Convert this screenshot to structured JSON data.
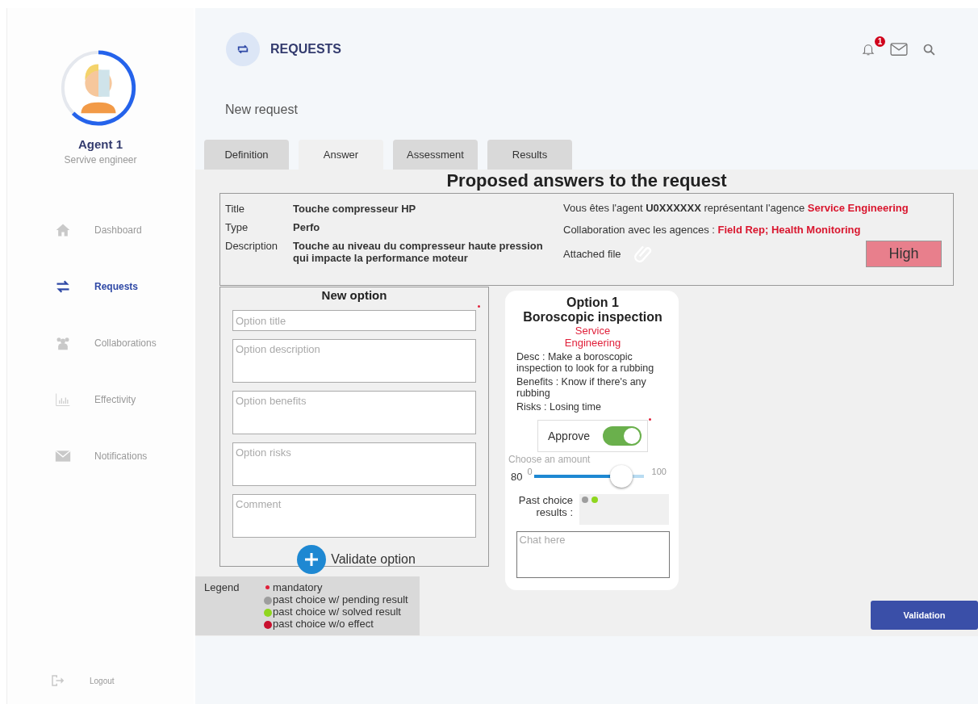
{
  "profile": {
    "name": "Agent 1",
    "role": "Servive engineer"
  },
  "nav": [
    {
      "label": "Dashboard",
      "selected": false
    },
    {
      "label": "Requests",
      "selected": true
    },
    {
      "label": "Collaborations",
      "selected": false
    },
    {
      "label": "Effectivity",
      "selected": false
    },
    {
      "label": "Notifications",
      "selected": false
    }
  ],
  "logout": "Logout",
  "header": {
    "title": "REQUESTS",
    "notification_count": "1",
    "subtitle": "New request"
  },
  "tabs": [
    {
      "label": "Definition",
      "selected": false
    },
    {
      "label": "Answer",
      "selected": true
    },
    {
      "label": "Assessment",
      "selected": false
    },
    {
      "label": "Results",
      "selected": false
    }
  ],
  "heading": "Proposed answers to the request",
  "request": {
    "fields": [
      {
        "label": "Title",
        "value": "Touche compresseur HP"
      },
      {
        "label": "Type",
        "value": "Perfo"
      },
      {
        "label": "Description",
        "value": "Touche au niveau du compresseur haute pression qui impacte la performance moteur"
      }
    ],
    "agent_line": "Vous êtes l'agent **U0XXXXXX** représentant l'agence ",
    "agent_agency": "Service Engineering",
    "collab_line": "Collaboration avec les agences : ",
    "collab_agencies": "Field Rep; Health Monitoring",
    "attached_label": "Attached file",
    "priority": "High"
  },
  "new_option": {
    "title": "New option",
    "fields": [
      {
        "kind": "line",
        "placeholder": "Option title",
        "mandatory": true
      },
      {
        "kind": "area",
        "placeholder": "Option description",
        "mandatory": false
      },
      {
        "kind": "area",
        "placeholder": "Option benefits",
        "mandatory": false
      },
      {
        "kind": "area",
        "placeholder": "Option risks",
        "mandatory": false
      },
      {
        "kind": "area",
        "placeholder": "Comment",
        "mandatory": false
      }
    ],
    "button": "Validate option"
  },
  "option_card": {
    "number": "Option 1",
    "name": "Boroscopic inspection",
    "agency": "Service Engineering",
    "lines": [
      "Desc : Make a boroscopic inspection to look for a rubbing",
      "Benefits : Know if there's any rubbing",
      "Risks : Losing time"
    ],
    "approve": {
      "label": "Approve",
      "on": true,
      "mandatory": true
    },
    "amount": {
      "label": "Choose an amount",
      "value": "80",
      "min": "0",
      "max": "100",
      "level": 0.8
    },
    "past_label": "Past choice results :",
    "past_results": [
      {
        "color": "#9e9e9e"
      },
      {
        "color": "#8fd61f"
      }
    ],
    "chat_placeholder": "Chat here"
  },
  "legend": {
    "title": "Legend",
    "items": [
      {
        "kind": "star",
        "text": "mandatory",
        "color": "#e0203a"
      },
      {
        "kind": "dot",
        "text": "past choice w/ pending result",
        "color": "#9e9e9e"
      },
      {
        "kind": "dot",
        "text": "past choice w/ solved result",
        "color": "#8fd61f"
      },
      {
        "kind": "dot",
        "text": "past choice w/o effect",
        "color": "#c8102e"
      }
    ]
  },
  "validation_button": "Validation"
}
